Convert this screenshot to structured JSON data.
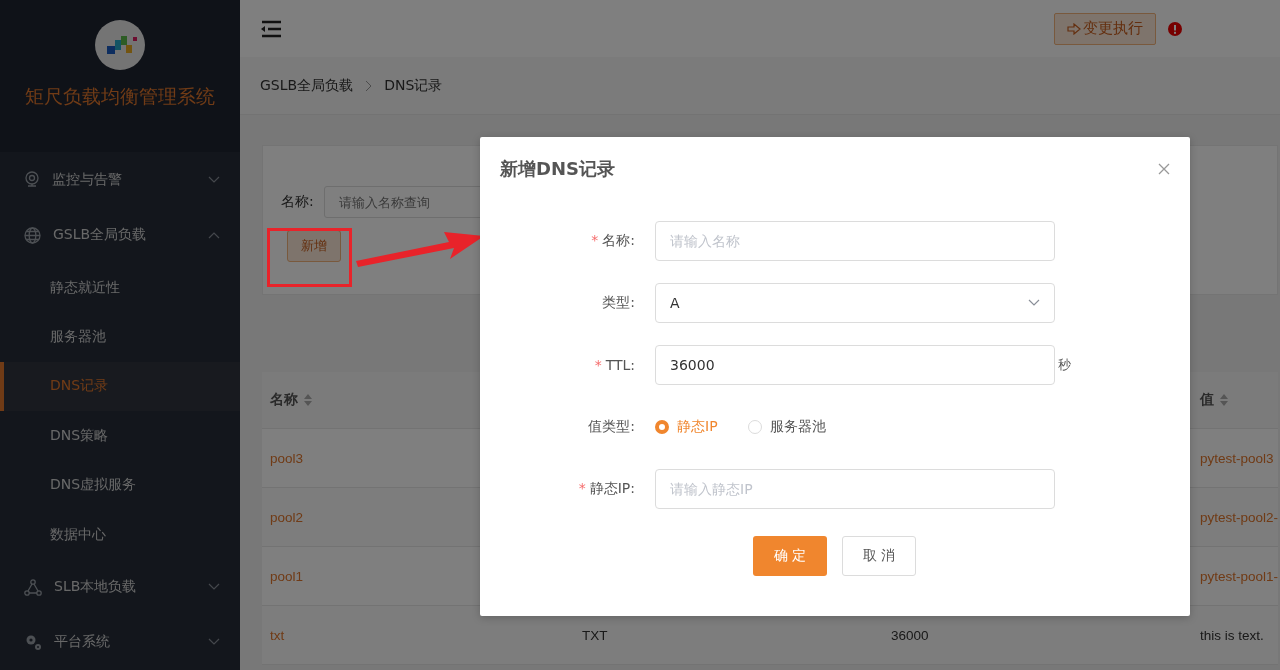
{
  "sidebar": {
    "title": "矩尺负载均衡管理系统",
    "menu": [
      {
        "label": "监控与告警",
        "expanded": false
      },
      {
        "label": "GSLB全局负载",
        "expanded": true,
        "children": [
          {
            "label": "静态就近性",
            "selected": false
          },
          {
            "label": "服务器池",
            "selected": false
          },
          {
            "label": "DNS记录",
            "selected": true
          },
          {
            "label": "DNS策略",
            "selected": false
          },
          {
            "label": "DNS虚拟服务",
            "selected": false
          },
          {
            "label": "数据中心",
            "selected": false
          }
        ]
      },
      {
        "label": "SLB本地负载",
        "expanded": false
      },
      {
        "label": "平台系统",
        "expanded": false
      }
    ]
  },
  "header": {
    "execute_button": "变更执行"
  },
  "breadcrumb": [
    "GSLB全局负载",
    "DNS记录"
  ],
  "filter": {
    "label": "名称:",
    "placeholder": "请输入名称查询",
    "add_button": "新增"
  },
  "table": {
    "columns": [
      "名称",
      "值"
    ],
    "rows": [
      {
        "name": "pool3",
        "value": "pytest-pool3",
        "kind": "link"
      },
      {
        "name": "pool2",
        "value": "pytest-pool2-",
        "kind": "link"
      },
      {
        "name": "pool1",
        "value": "pytest-pool1-",
        "kind": "link"
      },
      {
        "name": "txt",
        "type": "TXT",
        "ttl": "36000",
        "value": "this is text.",
        "kind": "plain"
      }
    ]
  },
  "dialog": {
    "title": "新增DNS记录",
    "fields": [
      {
        "kind": "input",
        "required_mark": "*",
        "label": "名称:",
        "placeholder": "请输入名称"
      },
      {
        "kind": "select",
        "label": "类型:",
        "value": "A"
      },
      {
        "kind": "input",
        "required_mark": "*",
        "label": "TTL:",
        "value": "36000",
        "suffix": "秒"
      },
      {
        "kind": "radio",
        "label": "值类型:",
        "options": [
          {
            "label": "静态IP",
            "selected": true
          },
          {
            "label": "服务器池",
            "selected": false
          }
        ]
      },
      {
        "kind": "input",
        "required_mark": "*",
        "label": "静态IP:",
        "placeholder": "请输入静态IP"
      }
    ],
    "buttons": {
      "ok": "确 定",
      "cancel": "取 消"
    }
  }
}
